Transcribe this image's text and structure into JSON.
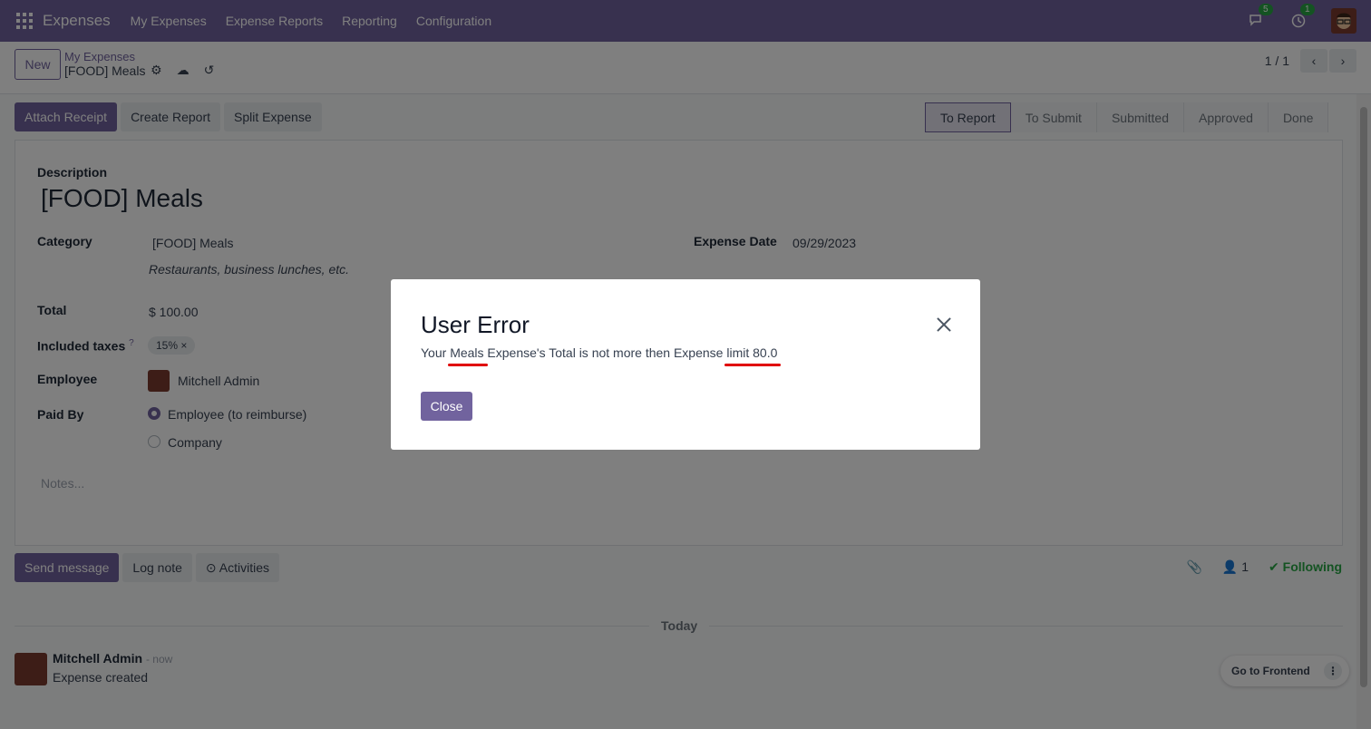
{
  "navbar": {
    "brand": "Expenses",
    "menu": [
      "My Expenses",
      "Expense Reports",
      "Reporting",
      "Configuration"
    ],
    "messages_count": "5",
    "activities_count": "1",
    "bg_color": "#71639e"
  },
  "control": {
    "new_label": "New",
    "breadcrumb_parent": "My Expenses",
    "breadcrumb_current": "[FOOD] Meals",
    "pager": "1 / 1"
  },
  "actions": {
    "attach_receipt": "Attach Receipt",
    "create_report": "Create Report",
    "split_expense": "Split Expense"
  },
  "stages": [
    "To Report",
    "To Submit",
    "Submitted",
    "Approved",
    "Done"
  ],
  "form": {
    "description_label": "Description",
    "description": "[FOOD] Meals",
    "category_label": "Category",
    "category": "[FOOD] Meals",
    "category_help": "Restaurants, business lunches, etc.",
    "expense_date_label": "Expense Date",
    "expense_date": "09/29/2023",
    "total_label": "Total",
    "total": "$ 100.00",
    "taxes_label": "Included taxes",
    "taxes_help": "?",
    "tax_tag": "15% ×",
    "employee_label": "Employee",
    "employee": "Mitchell Admin",
    "paid_by_label": "Paid By",
    "paid_by_options": [
      "Employee (to reimburse)",
      "Company"
    ],
    "notes_placeholder": "Notes..."
  },
  "chatter": {
    "send_message": "Send message",
    "log_note": "Log note",
    "activities": "⊙ Activities",
    "followers_count": "1",
    "following": "Following",
    "today": "Today",
    "author": "Mitchell Admin",
    "time": "- now",
    "body": "Expense created",
    "go_frontend": "Go to Frontend"
  },
  "dialog": {
    "title": "User Error",
    "msg_part1": "Your ",
    "msg_meals": "Meals",
    "msg_part2": " Expense's Total is not more then Expense ",
    "msg_limit": "limit 80.0",
    "close_label": "Close",
    "underline_color": "#e00000"
  }
}
